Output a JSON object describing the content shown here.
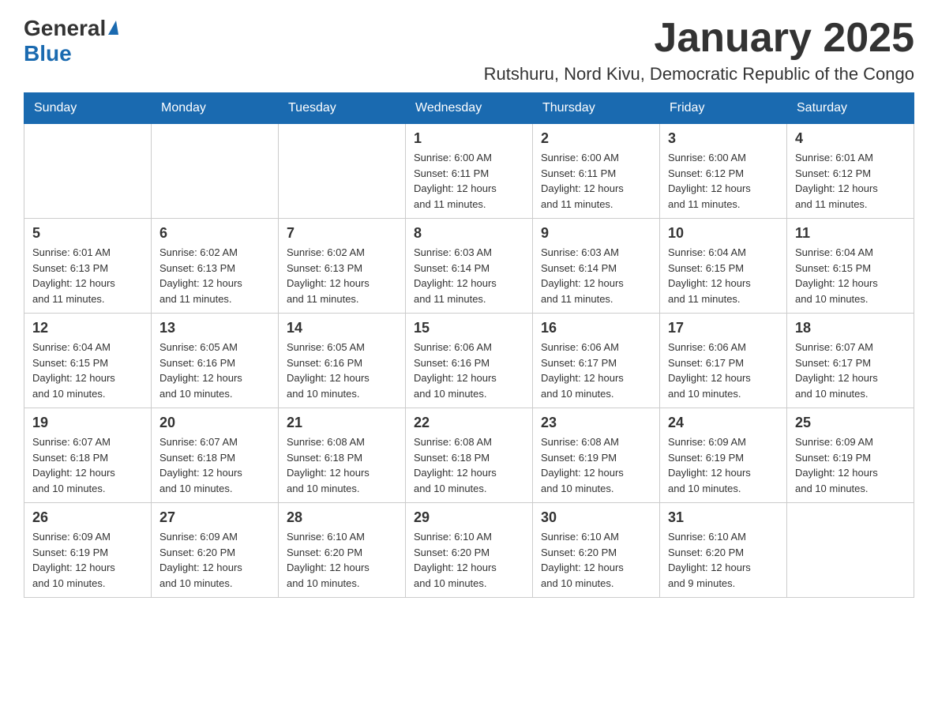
{
  "header": {
    "logo_general": "General",
    "logo_blue": "Blue",
    "month_title": "January 2025",
    "location": "Rutshuru, Nord Kivu, Democratic Republic of the Congo"
  },
  "weekdays": [
    "Sunday",
    "Monday",
    "Tuesday",
    "Wednesday",
    "Thursday",
    "Friday",
    "Saturday"
  ],
  "weeks": [
    [
      {
        "day": "",
        "info": ""
      },
      {
        "day": "",
        "info": ""
      },
      {
        "day": "",
        "info": ""
      },
      {
        "day": "1",
        "info": "Sunrise: 6:00 AM\nSunset: 6:11 PM\nDaylight: 12 hours\nand 11 minutes."
      },
      {
        "day": "2",
        "info": "Sunrise: 6:00 AM\nSunset: 6:11 PM\nDaylight: 12 hours\nand 11 minutes."
      },
      {
        "day": "3",
        "info": "Sunrise: 6:00 AM\nSunset: 6:12 PM\nDaylight: 12 hours\nand 11 minutes."
      },
      {
        "day": "4",
        "info": "Sunrise: 6:01 AM\nSunset: 6:12 PM\nDaylight: 12 hours\nand 11 minutes."
      }
    ],
    [
      {
        "day": "5",
        "info": "Sunrise: 6:01 AM\nSunset: 6:13 PM\nDaylight: 12 hours\nand 11 minutes."
      },
      {
        "day": "6",
        "info": "Sunrise: 6:02 AM\nSunset: 6:13 PM\nDaylight: 12 hours\nand 11 minutes."
      },
      {
        "day": "7",
        "info": "Sunrise: 6:02 AM\nSunset: 6:13 PM\nDaylight: 12 hours\nand 11 minutes."
      },
      {
        "day": "8",
        "info": "Sunrise: 6:03 AM\nSunset: 6:14 PM\nDaylight: 12 hours\nand 11 minutes."
      },
      {
        "day": "9",
        "info": "Sunrise: 6:03 AM\nSunset: 6:14 PM\nDaylight: 12 hours\nand 11 minutes."
      },
      {
        "day": "10",
        "info": "Sunrise: 6:04 AM\nSunset: 6:15 PM\nDaylight: 12 hours\nand 11 minutes."
      },
      {
        "day": "11",
        "info": "Sunrise: 6:04 AM\nSunset: 6:15 PM\nDaylight: 12 hours\nand 10 minutes."
      }
    ],
    [
      {
        "day": "12",
        "info": "Sunrise: 6:04 AM\nSunset: 6:15 PM\nDaylight: 12 hours\nand 10 minutes."
      },
      {
        "day": "13",
        "info": "Sunrise: 6:05 AM\nSunset: 6:16 PM\nDaylight: 12 hours\nand 10 minutes."
      },
      {
        "day": "14",
        "info": "Sunrise: 6:05 AM\nSunset: 6:16 PM\nDaylight: 12 hours\nand 10 minutes."
      },
      {
        "day": "15",
        "info": "Sunrise: 6:06 AM\nSunset: 6:16 PM\nDaylight: 12 hours\nand 10 minutes."
      },
      {
        "day": "16",
        "info": "Sunrise: 6:06 AM\nSunset: 6:17 PM\nDaylight: 12 hours\nand 10 minutes."
      },
      {
        "day": "17",
        "info": "Sunrise: 6:06 AM\nSunset: 6:17 PM\nDaylight: 12 hours\nand 10 minutes."
      },
      {
        "day": "18",
        "info": "Sunrise: 6:07 AM\nSunset: 6:17 PM\nDaylight: 12 hours\nand 10 minutes."
      }
    ],
    [
      {
        "day": "19",
        "info": "Sunrise: 6:07 AM\nSunset: 6:18 PM\nDaylight: 12 hours\nand 10 minutes."
      },
      {
        "day": "20",
        "info": "Sunrise: 6:07 AM\nSunset: 6:18 PM\nDaylight: 12 hours\nand 10 minutes."
      },
      {
        "day": "21",
        "info": "Sunrise: 6:08 AM\nSunset: 6:18 PM\nDaylight: 12 hours\nand 10 minutes."
      },
      {
        "day": "22",
        "info": "Sunrise: 6:08 AM\nSunset: 6:18 PM\nDaylight: 12 hours\nand 10 minutes."
      },
      {
        "day": "23",
        "info": "Sunrise: 6:08 AM\nSunset: 6:19 PM\nDaylight: 12 hours\nand 10 minutes."
      },
      {
        "day": "24",
        "info": "Sunrise: 6:09 AM\nSunset: 6:19 PM\nDaylight: 12 hours\nand 10 minutes."
      },
      {
        "day": "25",
        "info": "Sunrise: 6:09 AM\nSunset: 6:19 PM\nDaylight: 12 hours\nand 10 minutes."
      }
    ],
    [
      {
        "day": "26",
        "info": "Sunrise: 6:09 AM\nSunset: 6:19 PM\nDaylight: 12 hours\nand 10 minutes."
      },
      {
        "day": "27",
        "info": "Sunrise: 6:09 AM\nSunset: 6:20 PM\nDaylight: 12 hours\nand 10 minutes."
      },
      {
        "day": "28",
        "info": "Sunrise: 6:10 AM\nSunset: 6:20 PM\nDaylight: 12 hours\nand 10 minutes."
      },
      {
        "day": "29",
        "info": "Sunrise: 6:10 AM\nSunset: 6:20 PM\nDaylight: 12 hours\nand 10 minutes."
      },
      {
        "day": "30",
        "info": "Sunrise: 6:10 AM\nSunset: 6:20 PM\nDaylight: 12 hours\nand 10 minutes."
      },
      {
        "day": "31",
        "info": "Sunrise: 6:10 AM\nSunset: 6:20 PM\nDaylight: 12 hours\nand 9 minutes."
      },
      {
        "day": "",
        "info": ""
      }
    ]
  ]
}
